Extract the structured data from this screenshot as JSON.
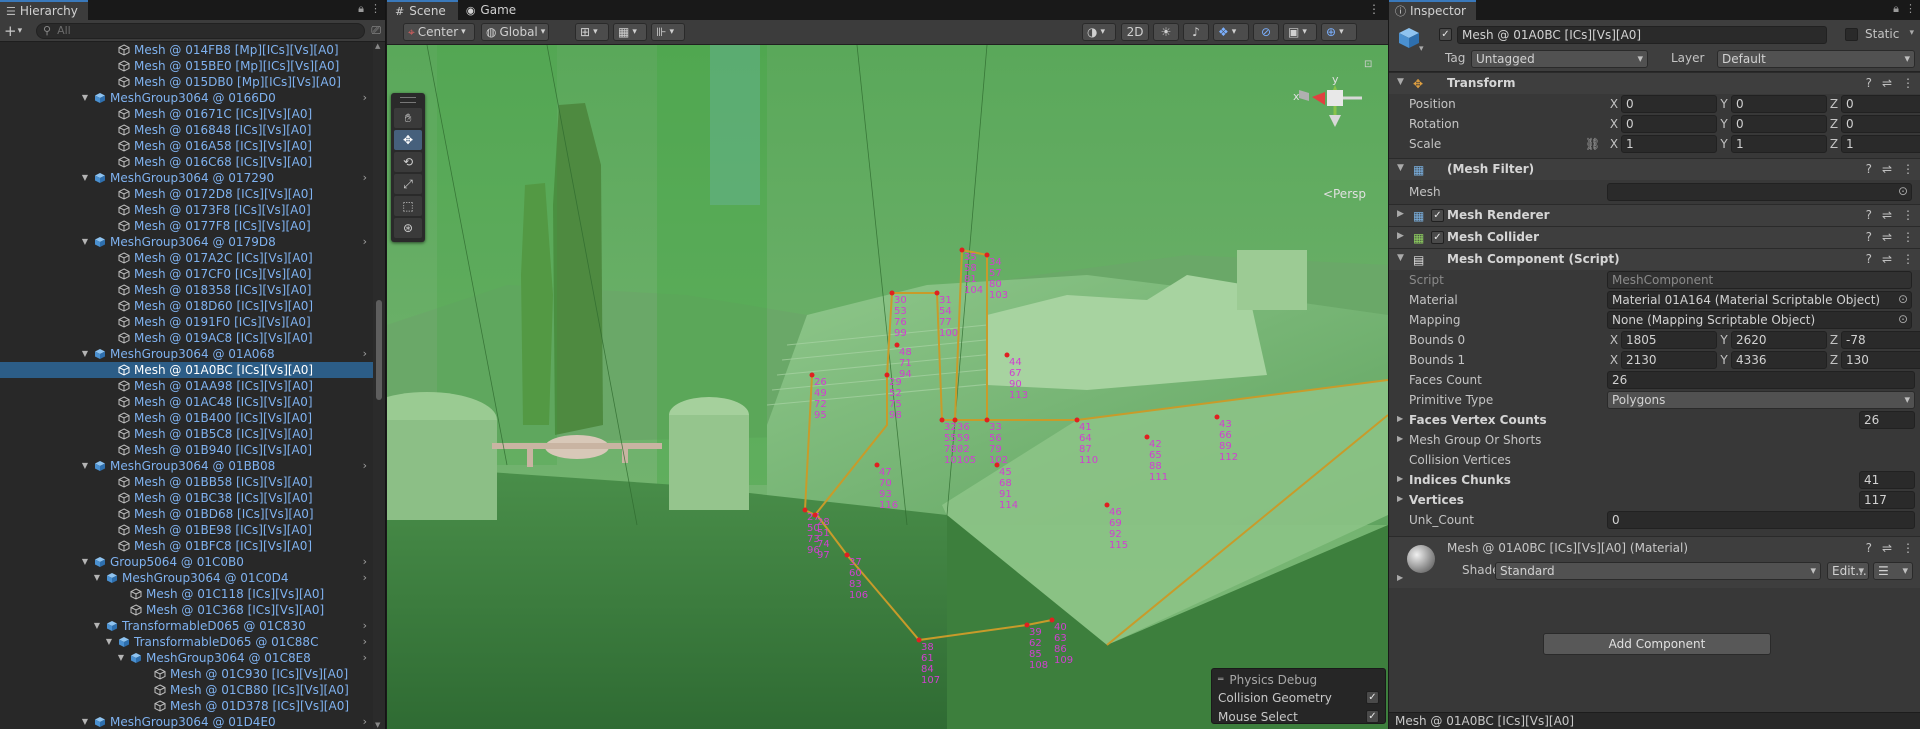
{
  "hierarchy": {
    "tab_label": "Hierarchy",
    "search_placeholder": "All",
    "rows": [
      {
        "label": "Mesh @ 014FB8 [Mp][ICs][Vs][A0]",
        "kind": "mesh",
        "depth": 2
      },
      {
        "label": "Mesh @ 015BE0 [Mp][ICs][Vs][A0]",
        "kind": "mesh",
        "depth": 2
      },
      {
        "label": "Mesh @ 015DB0 [Mp][ICs][Vs][A0]",
        "kind": "mesh",
        "depth": 2
      },
      {
        "label": "MeshGroup3064 @ 0166D0",
        "kind": "group",
        "depth": 1
      },
      {
        "label": "Mesh @ 01671C [ICs][Vs][A0]",
        "kind": "mesh",
        "depth": 2
      },
      {
        "label": "Mesh @ 016848 [ICs][Vs][A0]",
        "kind": "mesh",
        "depth": 2
      },
      {
        "label": "Mesh @ 016A58 [ICs][Vs][A0]",
        "kind": "mesh",
        "depth": 2
      },
      {
        "label": "Mesh @ 016C68 [ICs][Vs][A0]",
        "kind": "mesh",
        "depth": 2
      },
      {
        "label": "MeshGroup3064 @ 017290",
        "kind": "group",
        "depth": 1
      },
      {
        "label": "Mesh @ 0172D8 [ICs][Vs][A0]",
        "kind": "mesh",
        "depth": 2
      },
      {
        "label": "Mesh @ 0173F8 [ICs][Vs][A0]",
        "kind": "mesh",
        "depth": 2
      },
      {
        "label": "Mesh @ 0177F8 [ICs][Vs][A0]",
        "kind": "mesh",
        "depth": 2
      },
      {
        "label": "MeshGroup3064 @ 0179D8",
        "kind": "group",
        "depth": 1
      },
      {
        "label": "Mesh @ 017A2C [ICs][Vs][A0]",
        "kind": "mesh",
        "depth": 2
      },
      {
        "label": "Mesh @ 017CF0 [ICs][Vs][A0]",
        "kind": "mesh",
        "depth": 2
      },
      {
        "label": "Mesh @ 018358 [ICs][Vs][A0]",
        "kind": "mesh",
        "depth": 2
      },
      {
        "label": "Mesh @ 018D60 [ICs][Vs][A0]",
        "kind": "mesh",
        "depth": 2
      },
      {
        "label": "Mesh @ 0191F0 [ICs][Vs][A0]",
        "kind": "mesh",
        "depth": 2
      },
      {
        "label": "Mesh @ 019AC8 [ICs][Vs][A0]",
        "kind": "mesh",
        "depth": 2
      },
      {
        "label": "MeshGroup3064 @ 01A068",
        "kind": "group",
        "depth": 1
      },
      {
        "label": "Mesh @ 01A0BC [ICs][Vs][A0]",
        "kind": "mesh",
        "depth": 2,
        "selected": true
      },
      {
        "label": "Mesh @ 01AA98 [ICs][Vs][A0]",
        "kind": "mesh",
        "depth": 2
      },
      {
        "label": "Mesh @ 01AC48 [ICs][Vs][A0]",
        "kind": "mesh",
        "depth": 2
      },
      {
        "label": "Mesh @ 01B400 [ICs][Vs][A0]",
        "kind": "mesh",
        "depth": 2
      },
      {
        "label": "Mesh @ 01B5C8 [ICs][Vs][A0]",
        "kind": "mesh",
        "depth": 2
      },
      {
        "label": "Mesh @ 01B940 [ICs][Vs][A0]",
        "kind": "mesh",
        "depth": 2
      },
      {
        "label": "MeshGroup3064 @ 01BB08",
        "kind": "group",
        "depth": 1
      },
      {
        "label": "Mesh @ 01BB58 [ICs][Vs][A0]",
        "kind": "mesh",
        "depth": 2
      },
      {
        "label": "Mesh @ 01BC38 [ICs][Vs][A0]",
        "kind": "mesh",
        "depth": 2
      },
      {
        "label": "Mesh @ 01BD68 [ICs][Vs][A0]",
        "kind": "mesh",
        "depth": 2
      },
      {
        "label": "Mesh @ 01BE98 [ICs][Vs][A0]",
        "kind": "mesh",
        "depth": 2
      },
      {
        "label": "Mesh @ 01BFC8 [ICs][Vs][A0]",
        "kind": "mesh",
        "depth": 2
      },
      {
        "label": "Group5064 @ 01C0B0",
        "kind": "group",
        "depth": 1
      },
      {
        "label": "MeshGroup3064 @ 01C0D4",
        "kind": "group",
        "depth": 2
      },
      {
        "label": "Mesh @ 01C118 [ICs][Vs][A0]",
        "kind": "mesh",
        "depth": 3
      },
      {
        "label": "Mesh @ 01C368 [ICs][Vs][A0]",
        "kind": "mesh",
        "depth": 3
      },
      {
        "label": "TransformableD065 @ 01C830",
        "kind": "group",
        "depth": 2
      },
      {
        "label": "TransformableD065 @ 01C88C",
        "kind": "group",
        "depth": 3
      },
      {
        "label": "MeshGroup3064 @ 01C8E8",
        "kind": "group",
        "depth": 4
      },
      {
        "label": "Mesh @ 01C930 [ICs][Vs][A0]",
        "kind": "mesh",
        "depth": 5
      },
      {
        "label": "Mesh @ 01CB80 [ICs][Vs][A0]",
        "kind": "mesh",
        "depth": 5
      },
      {
        "label": "Mesh @ 01D378 [ICs][Vs][A0]",
        "kind": "mesh",
        "depth": 5
      },
      {
        "label": "MeshGroup3064 @ 01D4E0",
        "kind": "group",
        "depth": 1
      }
    ]
  },
  "scene": {
    "tabs": [
      {
        "label": "Scene",
        "icon": "grid-icon"
      },
      {
        "label": "Game",
        "icon": "gamepad-icon"
      }
    ],
    "pivot_mode": "Center",
    "pivot_rotation": "Global",
    "view_2d_label": "2D",
    "persp_label": "Persp",
    "axis_labels": {
      "y": "y",
      "x": "x"
    },
    "physics_debug": {
      "title": "Physics Debug",
      "items": [
        {
          "label": "Collision Geometry",
          "checked": true
        },
        {
          "label": "Mouse Select",
          "checked": true
        }
      ]
    },
    "vertex_labels": [
      "26",
      "27",
      "28",
      "29",
      "30",
      "31",
      "32",
      "33",
      "34",
      "35",
      "36",
      "37",
      "38",
      "39",
      "40",
      "41",
      "42",
      "43",
      "44",
      "45",
      "46",
      "47",
      "48",
      "49",
      "50",
      "51",
      "52",
      "53",
      "54",
      "55",
      "56",
      "57",
      "58",
      "59",
      "60",
      "61",
      "62",
      "63",
      "64",
      "65",
      "66",
      "67",
      "68",
      "69",
      "70",
      "71",
      "72",
      "73",
      "74",
      "75",
      "76",
      "77",
      "78",
      "79",
      "80",
      "81",
      "82",
      "83",
      "84",
      "85",
      "86",
      "87",
      "88",
      "89",
      "90",
      "91",
      "92",
      "93",
      "94",
      "95",
      "96",
      "97",
      "98",
      "99",
      "100",
      "101",
      "102",
      "103",
      "104",
      "105",
      "106",
      "107",
      "108",
      "109",
      "110",
      "111",
      "112",
      "113",
      "114",
      "115",
      "116"
    ],
    "colors": {
      "collision_green": "#4caf50",
      "collider_edge": "#c8a030",
      "vertex_point": "#e02020",
      "vertex_label": "#d040d0"
    }
  },
  "inspector": {
    "tab_label": "Inspector",
    "object_name": "Mesh @ 01A0BC [ICs][Vs][A0]",
    "active": true,
    "static_label": "Static",
    "tag_label": "Tag",
    "tag_value": "Untagged",
    "layer_label": "Layer",
    "layer_value": "Default",
    "transform": {
      "title": "Transform",
      "position_label": "Position",
      "rotation_label": "Rotation",
      "scale_label": "Scale",
      "position": {
        "x": "0",
        "y": "0",
        "z": "0"
      },
      "rotation": {
        "x": "0",
        "y": "0",
        "z": "0"
      },
      "scale": {
        "x": "1",
        "y": "1",
        "z": "1"
      }
    },
    "mesh_filter": {
      "title": "(Mesh Filter)",
      "mesh_label": "Mesh",
      "mesh_value": ""
    },
    "mesh_renderer": {
      "title": "Mesh Renderer",
      "enabled": true
    },
    "mesh_collider": {
      "title": "Mesh Collider",
      "enabled": true
    },
    "mesh_component": {
      "title": "Mesh Component (Script)",
      "script_label": "Script",
      "script_value": "MeshComponent",
      "material_label": "Material",
      "material_value": "Material 01A164 (Material Scriptable Object)",
      "mapping_label": "Mapping",
      "mapping_value": "None (Mapping Scriptable Object)",
      "bounds0_label": "Bounds 0",
      "bounds0": {
        "x": "1805",
        "y": "2620",
        "z": "-78"
      },
      "bounds1_label": "Bounds 1",
      "bounds1": {
        "x": "2130",
        "y": "4336",
        "z": "130"
      },
      "faces_count_label": "Faces Count",
      "faces_count": "26",
      "primitive_type_label": "Primitive Type",
      "primitive_type": "Polygons",
      "faces_vertex_counts_label": "Faces Vertex Counts",
      "faces_vertex_counts": "26",
      "mesh_group_or_shorts_label": "Mesh Group Or Shorts",
      "collision_vertices_label": "Collision Vertices",
      "indices_chunks_label": "Indices Chunks",
      "indices_chunks": "41",
      "vertices_label": "Vertices",
      "vertices": "117",
      "unk_count_label": "Unk_Count",
      "unk_count": "0"
    },
    "material": {
      "title": "Mesh @ 01A0BC [ICs][Vs][A0] (Material)",
      "shader_label": "Shader",
      "shader_value": "Standard",
      "edit_label": "Edit..."
    },
    "add_component_label": "Add Component",
    "footer_label": "Mesh @ 01A0BC [ICs][Vs][A0]"
  }
}
